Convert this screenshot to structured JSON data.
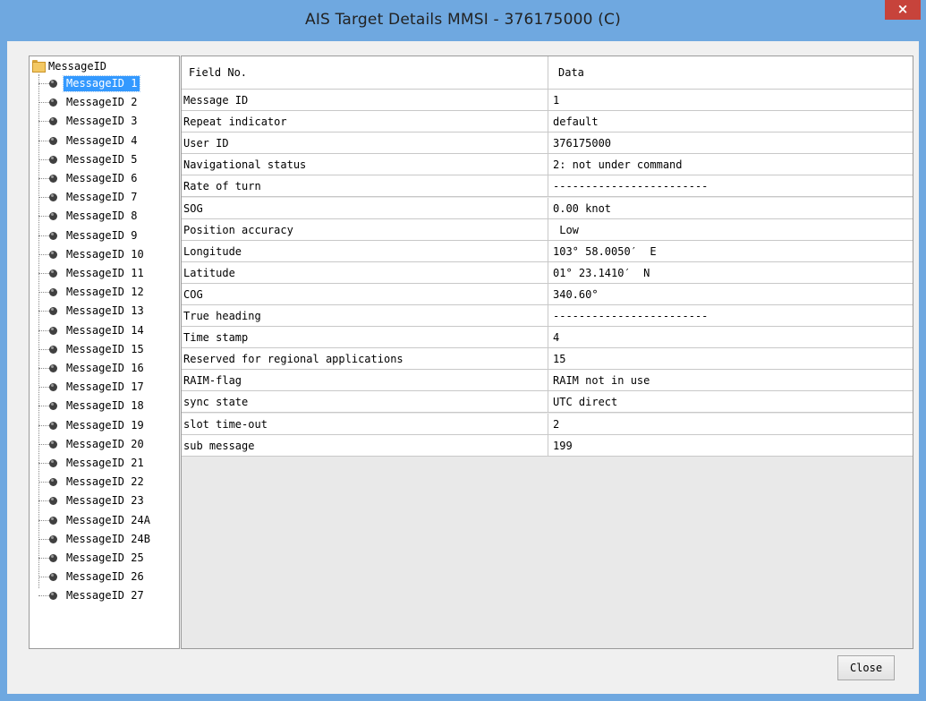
{
  "window": {
    "title": "AIS Target Details MMSI - 376175000 (C)",
    "close_glyph": "×"
  },
  "tree": {
    "root_label": "MessageID",
    "items": [
      {
        "label": "MessageID 1"
      },
      {
        "label": "MessageID 2"
      },
      {
        "label": "MessageID 3"
      },
      {
        "label": "MessageID 4"
      },
      {
        "label": "MessageID 5"
      },
      {
        "label": "MessageID 6"
      },
      {
        "label": "MessageID 7"
      },
      {
        "label": "MessageID 8"
      },
      {
        "label": "MessageID 9"
      },
      {
        "label": "MessageID 10"
      },
      {
        "label": "MessageID 11"
      },
      {
        "label": "MessageID 12"
      },
      {
        "label": "MessageID 13"
      },
      {
        "label": "MessageID 14"
      },
      {
        "label": "MessageID 15"
      },
      {
        "label": "MessageID 16"
      },
      {
        "label": "MessageID 17"
      },
      {
        "label": "MessageID 18"
      },
      {
        "label": "MessageID 19"
      },
      {
        "label": "MessageID 20"
      },
      {
        "label": "MessageID 21"
      },
      {
        "label": "MessageID 22"
      },
      {
        "label": "MessageID 23"
      },
      {
        "label": "MessageID 24A"
      },
      {
        "label": "MessageID 24B"
      },
      {
        "label": "MessageID 25"
      },
      {
        "label": "MessageID 26"
      },
      {
        "label": "MessageID 27"
      }
    ],
    "selected_index": 0
  },
  "grid": {
    "columns": [
      "Field No.",
      "Data"
    ],
    "rows": [
      {
        "field": "Message ID",
        "value": "1"
      },
      {
        "field": "Repeat indicator",
        "value": "default"
      },
      {
        "field": "User ID",
        "value": "376175000"
      },
      {
        "field": "Navigational status",
        "value": "2: not under command"
      },
      {
        "field": "Rate of turn",
        "value": "------------------------"
      },
      {
        "field": "SOG",
        "value": "0.00 knot"
      },
      {
        "field": "Position accuracy",
        "value": " Low"
      },
      {
        "field": "Longitude",
        "value": "103° 58.0050′  E"
      },
      {
        "field": "Latitude",
        "value": "01° 23.1410′  N"
      },
      {
        "field": "COG",
        "value": "340.60°"
      },
      {
        "field": "True heading",
        "value": "------------------------"
      },
      {
        "field": "Time stamp",
        "value": "4"
      },
      {
        "field": "Reserved for regional applications",
        "value": "15"
      },
      {
        "field": "RAIM-flag",
        "value": "RAIM not in use"
      },
      {
        "field": "sync state",
        "value": "UTC direct"
      },
      {
        "field": "slot time-out",
        "value": "2"
      },
      {
        "field": "sub message",
        "value": "199"
      }
    ]
  },
  "footer": {
    "close_label": "Close"
  },
  "colors": {
    "titlebar": "#6fa8e0",
    "close_x": "#c7433b",
    "selection": "#3399ff"
  }
}
